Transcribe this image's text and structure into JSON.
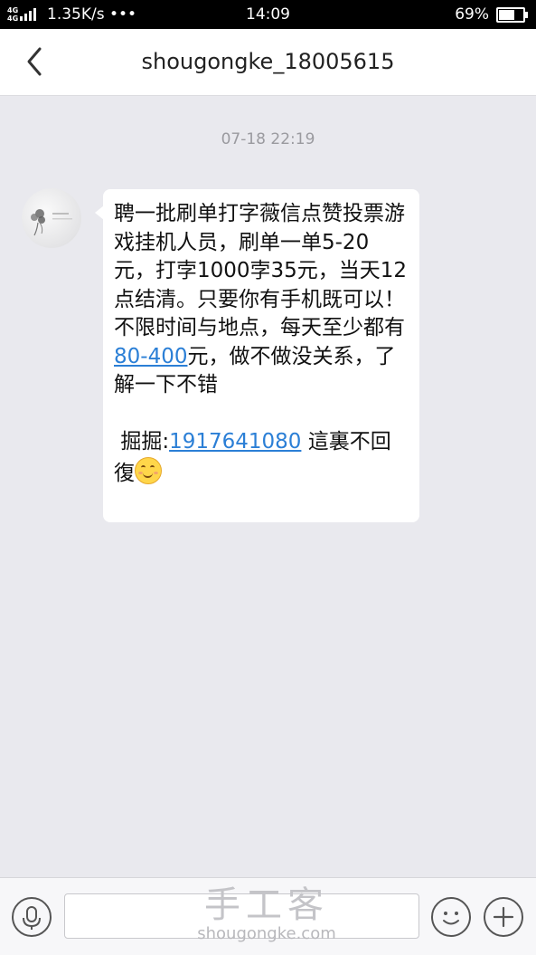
{
  "status_bar": {
    "signal_label": "4G 4G",
    "net_speed": "1.35K/s •••",
    "time": "14:09",
    "battery_percent": "69%",
    "battery_level": 0.69
  },
  "header": {
    "back_icon": "chevron-left-icon",
    "title": "shougongke_18005615"
  },
  "conversation": {
    "timestamp": "07-18 22:19",
    "message": {
      "text_part1": "聘一批刷单打字薇信点赞投票游戏挂机人员，刷单一单5-20元，打孛1000孛35元，当天12点结清。只要你有手机既可以！不限时间与地点，每天至少都有",
      "link_amount": "80-400",
      "text_part2": "元，做不做没关系，了解一下不错",
      "text_part3": " 掘掘:",
      "link_number": "1917641080",
      "text_part4": " 這裏不回復",
      "emoji": "smiling-face-icon"
    }
  },
  "bottom_bar": {
    "mic_icon": "microphone-icon",
    "emoji_icon": "smiley-icon",
    "plus_icon": "plus-icon",
    "watermark_main": "手工客",
    "watermark_sub": "shougongke.com"
  }
}
